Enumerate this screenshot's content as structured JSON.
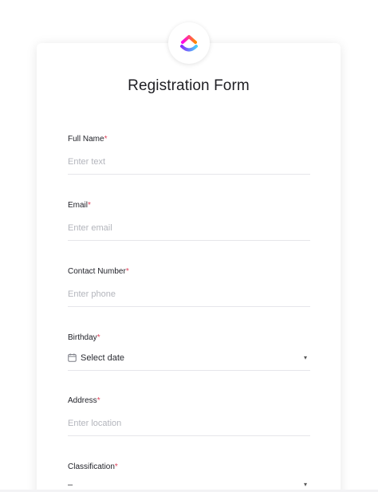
{
  "form": {
    "title": "Registration Form",
    "required_marker": "*",
    "fields": [
      {
        "label": "Full Name",
        "placeholder": "Enter text"
      },
      {
        "label": "Email",
        "placeholder": "Enter email"
      },
      {
        "label": "Contact Number",
        "placeholder": "Enter phone"
      },
      {
        "label": "Birthday",
        "value": "Select date"
      },
      {
        "label": "Address",
        "placeholder": "Enter location"
      },
      {
        "label": "Classification",
        "value": "–"
      }
    ]
  },
  "icons": {
    "logo": "clickup-logo-icon",
    "calendar": "calendar-icon",
    "chevron": "chevron-down-icon"
  },
  "colors": {
    "required": "#e0435c",
    "logo_gradient": [
      "#ff02f0",
      "#ff8a00",
      "#8930fd",
      "#49ccf9"
    ]
  }
}
